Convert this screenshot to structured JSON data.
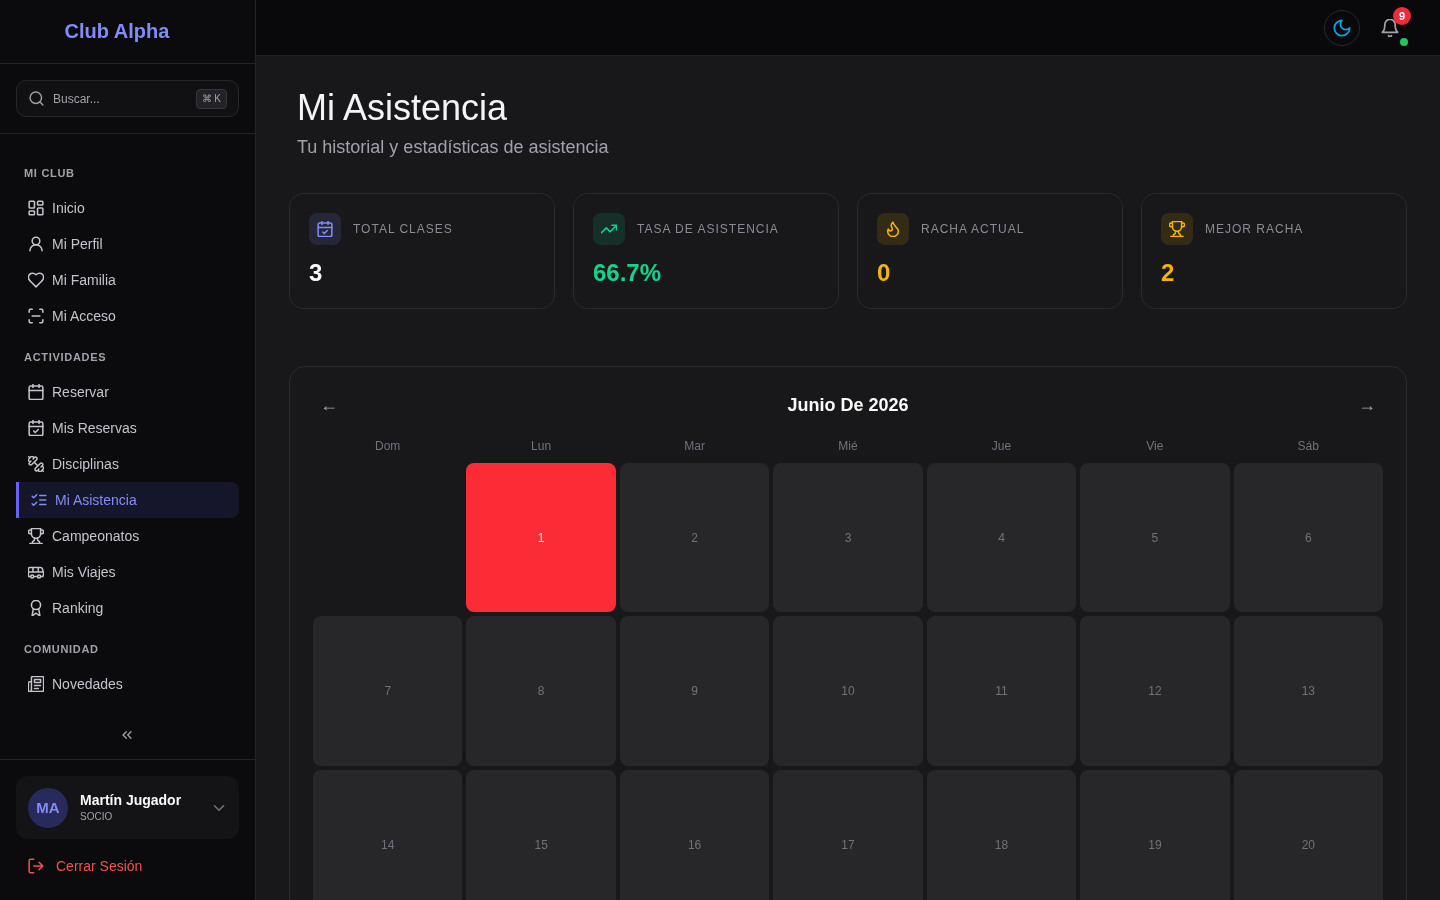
{
  "sidebar": {
    "brand": "Club Alpha",
    "search": {
      "placeholder": "Buscar...",
      "shortcut": "⌘ K"
    },
    "sections": [
      {
        "title": "MI CLUB",
        "items": [
          {
            "label": "Inicio",
            "selected": false
          },
          {
            "label": "Mi Perfil",
            "selected": false
          },
          {
            "label": "Mi Familia",
            "selected": false
          },
          {
            "label": "Mi Acceso",
            "selected": false
          }
        ]
      },
      {
        "title": "ACTIVIDADES",
        "items": [
          {
            "label": "Reservar",
            "selected": false
          },
          {
            "label": "Mis Reservas",
            "selected": false
          },
          {
            "label": "Disciplinas",
            "selected": false
          },
          {
            "label": "Mi Asistencia",
            "selected": true
          },
          {
            "label": "Campeonatos",
            "selected": false
          },
          {
            "label": "Mis Viajes",
            "selected": false
          },
          {
            "label": "Ranking",
            "selected": false
          }
        ]
      },
      {
        "title": "COMUNIDAD",
        "items": [
          {
            "label": "Novedades",
            "selected": false
          }
        ]
      }
    ],
    "user": {
      "initials": "MA",
      "name": "Martín Jugador",
      "role": "SOCIO"
    },
    "logout": "Cerrar Sesión"
  },
  "topbar": {
    "notifications": {
      "count": "9",
      "online": true
    }
  },
  "page": {
    "title": "Mi Asistencia",
    "subtitle": "Tu historial y estadísticas de asistencia"
  },
  "stats": [
    {
      "kind": "plain",
      "label": "TOTAL CLASES",
      "value": "3",
      "color": "#818cf8"
    },
    {
      "kind": "accent",
      "label": "TASA DE ASISTENCIA",
      "value": "66.7%",
      "color": "#12d48c"
    },
    {
      "kind": "accent",
      "label": "RACHA ACTUAL",
      "value": "0",
      "color": "#f5b400"
    },
    {
      "kind": "accent",
      "label": "MEJOR RACHA",
      "value": "2",
      "color": "#f5b400"
    }
  ],
  "calendar": {
    "title": "Junio De 2026",
    "prev": "←",
    "next": "→",
    "weekdays": [
      "Dom",
      "Lun",
      "Mar",
      "Mié",
      "Jue",
      "Vie",
      "Sáb"
    ],
    "days": [
      {
        "kind": "blank"
      },
      {
        "kind": "day",
        "label": "1",
        "highlighted": true
      },
      {
        "kind": "day",
        "label": "2",
        "highlighted": false
      },
      {
        "kind": "day",
        "label": "3",
        "highlighted": false
      },
      {
        "kind": "day",
        "label": "4",
        "highlighted": false
      },
      {
        "kind": "day",
        "label": "5",
        "highlighted": false
      },
      {
        "kind": "day",
        "label": "6",
        "highlighted": false
      },
      {
        "kind": "day",
        "label": "7",
        "highlighted": false
      },
      {
        "kind": "day",
        "label": "8",
        "highlighted": false
      },
      {
        "kind": "day",
        "label": "9",
        "highlighted": false
      },
      {
        "kind": "day",
        "label": "10",
        "highlighted": false
      },
      {
        "kind": "day",
        "label": "11",
        "highlighted": false
      },
      {
        "kind": "day",
        "label": "12",
        "highlighted": false
      },
      {
        "kind": "day",
        "label": "13",
        "highlighted": false
      },
      {
        "kind": "day",
        "label": "14",
        "highlighted": false
      },
      {
        "kind": "day",
        "label": "15",
        "highlighted": false
      },
      {
        "kind": "day",
        "label": "16",
        "highlighted": false
      },
      {
        "kind": "day",
        "label": "17",
        "highlighted": false
      },
      {
        "kind": "day",
        "label": "18",
        "highlighted": false
      },
      {
        "kind": "day",
        "label": "19",
        "highlighted": false
      },
      {
        "kind": "day",
        "label": "20",
        "highlighted": false
      }
    ]
  }
}
